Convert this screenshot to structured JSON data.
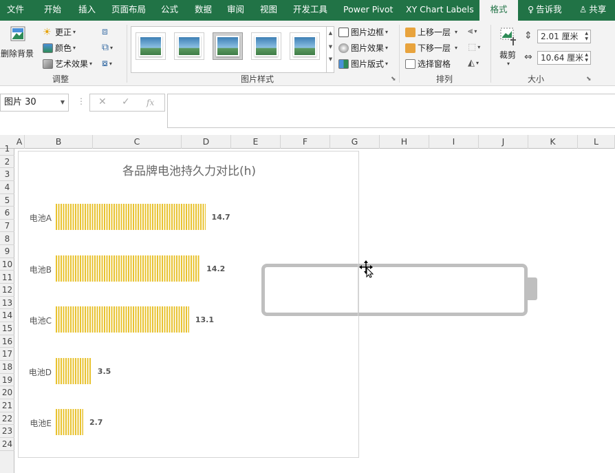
{
  "tabs": [
    {
      "label": "文件"
    },
    {
      "label": "开始"
    },
    {
      "label": "插入"
    },
    {
      "label": "页面布局"
    },
    {
      "label": "公式"
    },
    {
      "label": "数据"
    },
    {
      "label": "审阅"
    },
    {
      "label": "视图"
    },
    {
      "label": "开发工具"
    },
    {
      "label": "Power Pivot"
    },
    {
      "label": "XY Chart Labels"
    },
    {
      "label": "格式"
    }
  ],
  "tell_me": "告诉我",
  "share": "共享",
  "ribbon": {
    "adjust": {
      "remove_bg": "删除背景",
      "corrections": "更正",
      "color": "颜色",
      "artistic": "艺术效果",
      "group": "调整"
    },
    "styles": {
      "border": "图片边框",
      "effects": "图片效果",
      "layout": "图片版式",
      "group": "图片样式"
    },
    "arrange": {
      "forward": "上移一层",
      "backward": "下移一层",
      "pane": "选择窗格",
      "group": "排列"
    },
    "size": {
      "crop": "裁剪",
      "height": "2.01 厘米",
      "width": "10.64 厘米",
      "group": "大小"
    }
  },
  "formula_bar": {
    "name_box": "图片 30",
    "fx": "fx",
    "content": ""
  },
  "columns": [
    "A",
    "B",
    "C",
    "D",
    "E",
    "F",
    "G",
    "H",
    "I",
    "J",
    "K",
    "L"
  ],
  "rows": [
    "1",
    "2",
    "3",
    "4",
    "5",
    "6",
    "7",
    "8",
    "9",
    "10",
    "11",
    "12",
    "13",
    "14",
    "15",
    "16",
    "17",
    "18",
    "19",
    "20",
    "21",
    "22",
    "23",
    "24"
  ],
  "chart_data": {
    "type": "bar",
    "orientation": "horizontal",
    "title": "各品牌电池持久力对比(h)",
    "categories": [
      "电池A",
      "电池B",
      "电池C",
      "电池D",
      "电池E"
    ],
    "values": [
      14.7,
      14.2,
      13.1,
      3.5,
      2.7
    ],
    "xlim": [
      0,
      15
    ],
    "grid": false,
    "bar_color": "#e8c22e",
    "data_labels": true
  }
}
